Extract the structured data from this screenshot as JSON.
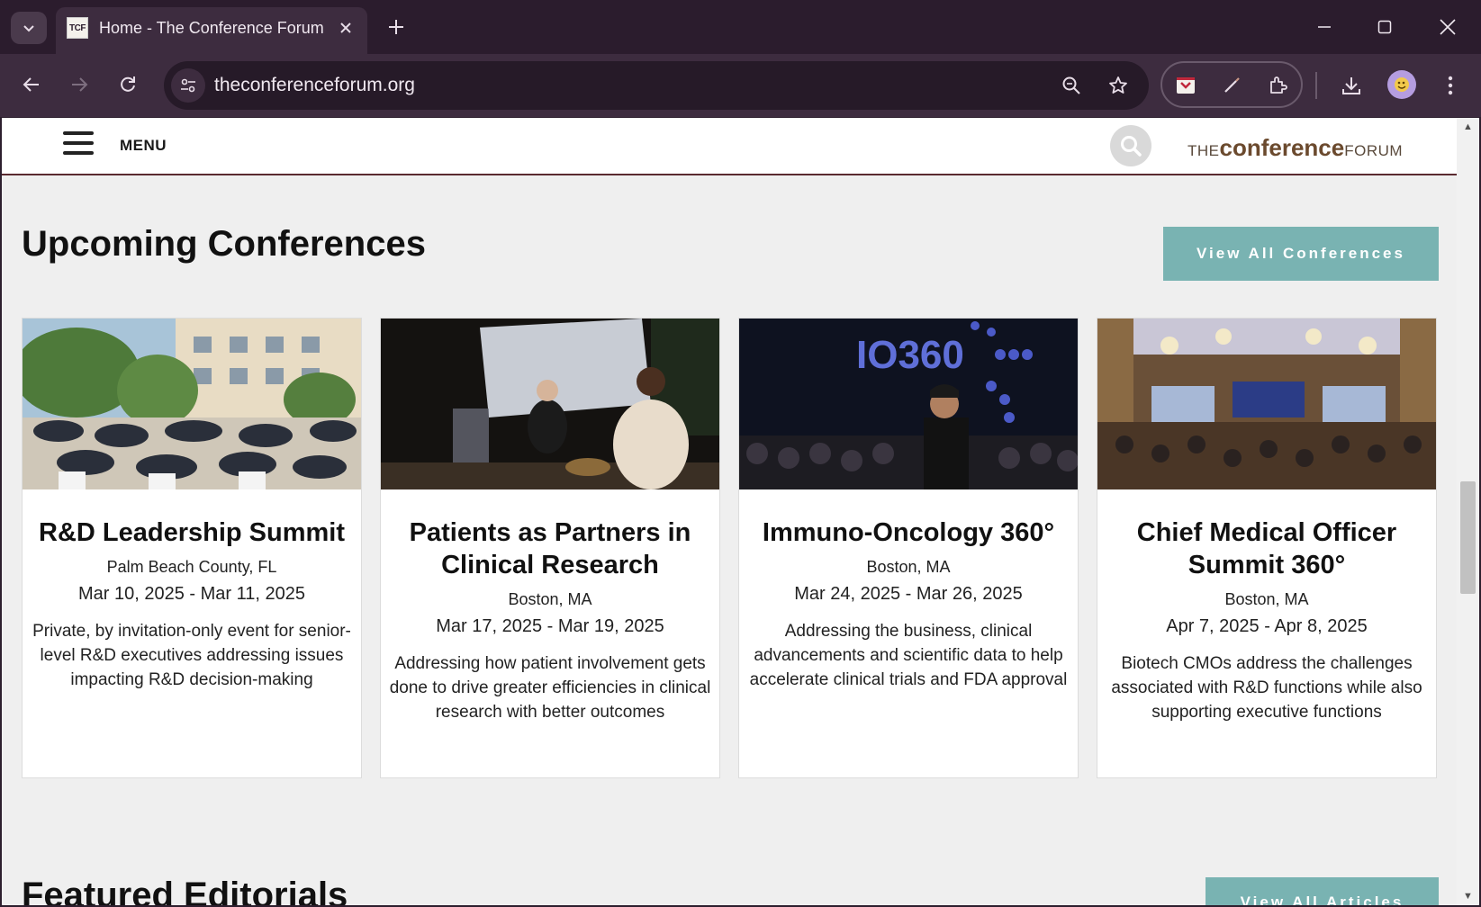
{
  "browser": {
    "tab_title": "Home - The Conference Forum",
    "tab_favicon_text": "TCF",
    "url": "theconferenceforum.org"
  },
  "site": {
    "menu_label": "MENU",
    "logo_the": "THE",
    "logo_conference": "conference",
    "logo_forum": "FORUM"
  },
  "upcoming": {
    "title": "Upcoming Conferences",
    "view_all_label": "View All Conferences",
    "cards": [
      {
        "title": "R&D Leadership Summit",
        "location": "Palm Beach County, FL",
        "dates": "Mar 10, 2025 - Mar 11, 2025",
        "description": "Private, by invitation-only event for senior-level R&D executives addressing issues impacting R&D decision-making",
        "image": "outdoor-garden-event-photo"
      },
      {
        "title": "Patients as Partners in Clinical Research",
        "location": "Boston, MA",
        "dates": "Mar 17, 2025 - Mar 19, 2025",
        "description": "Addressing how patient involvement gets done to drive greater efficiencies in clinical research with better outcomes",
        "image": "stage-panel-photo"
      },
      {
        "title": "Immuno-Oncology 360°",
        "location": "Boston, MA",
        "dates": "Mar 24, 2025 - Mar 26, 2025",
        "description": "Addressing the business, clinical advancements and scientific data to help accelerate clinical trials and FDA approval",
        "image": "speaker-at-mic-photo",
        "image_text": "IO360"
      },
      {
        "title": "Chief Medical Officer Summit 360°",
        "location": "Boston, MA",
        "dates": "Apr 7, 2025 - Apr 8, 2025",
        "description": "Biotech CMOs address the challenges associated with R&D functions while also supporting executive functions",
        "image": "ballroom-audience-photo"
      }
    ]
  },
  "editorials": {
    "title": "Featured Editorials",
    "view_all_label": "View All Articles"
  }
}
